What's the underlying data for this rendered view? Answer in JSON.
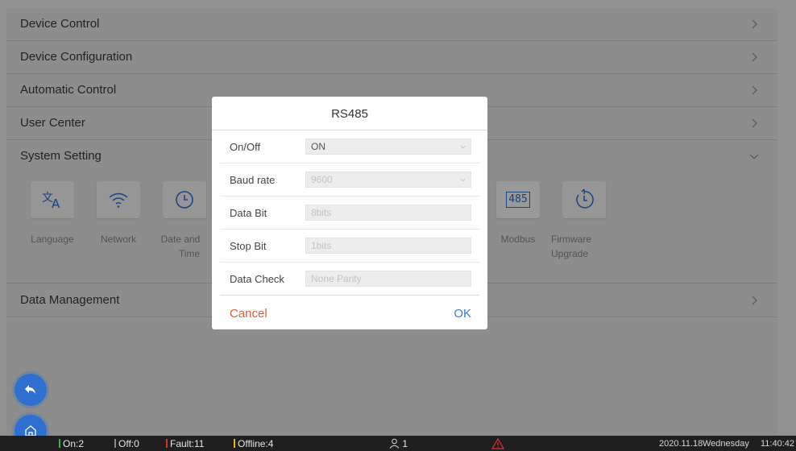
{
  "menu": {
    "device_control": "Device Control",
    "device_configuration": "Device Configuration",
    "automatic_control": "Automatic Control",
    "user_center": "User Center",
    "system_setting": "System Setting",
    "data_management": "Data Management"
  },
  "system_tiles": {
    "language": "Language",
    "network": "Network",
    "date_time_1": "Date and",
    "date_time_2": "Time",
    "modbus": "Modbus",
    "modbus_icon_text": "485",
    "firmware_1": "Firmware",
    "firmware_2": "Upgrade"
  },
  "dialog": {
    "title": "RS485",
    "fields": [
      {
        "label": "On/Off",
        "value": "ON"
      },
      {
        "label": "Baud rate",
        "value": "9600"
      },
      {
        "label": "Data Bit",
        "value": "8bits"
      },
      {
        "label": "Stop Bit",
        "value": "1bits"
      },
      {
        "label": "Data Check",
        "value": "None Parity"
      }
    ],
    "cancel": "Cancel",
    "ok": "OK"
  },
  "status": {
    "on": "On:2",
    "off": "Off:0",
    "fault": "Fault:11",
    "offline": "Offline:4",
    "users": "1",
    "date": "2020.11.18",
    "weekday": "Wednesday",
    "time": "11:40:42"
  },
  "colors": {
    "accent": "#2f6fd0",
    "cancel": "#e05c3d",
    "ok": "#3b78d8",
    "on": "#3bb34a",
    "off": "#8a8a8a",
    "fault": "#e0302a",
    "offline": "#f2b01e",
    "warning": "#e0302a"
  },
  "icons": [
    "chevron-right-icon",
    "chevron-down-icon",
    "language-icon",
    "wifi-icon",
    "clock-icon",
    "modbus-485-icon",
    "firmware-upgrade-icon",
    "back-arrow-icon",
    "home-icon",
    "user-icon",
    "warning-icon"
  ]
}
